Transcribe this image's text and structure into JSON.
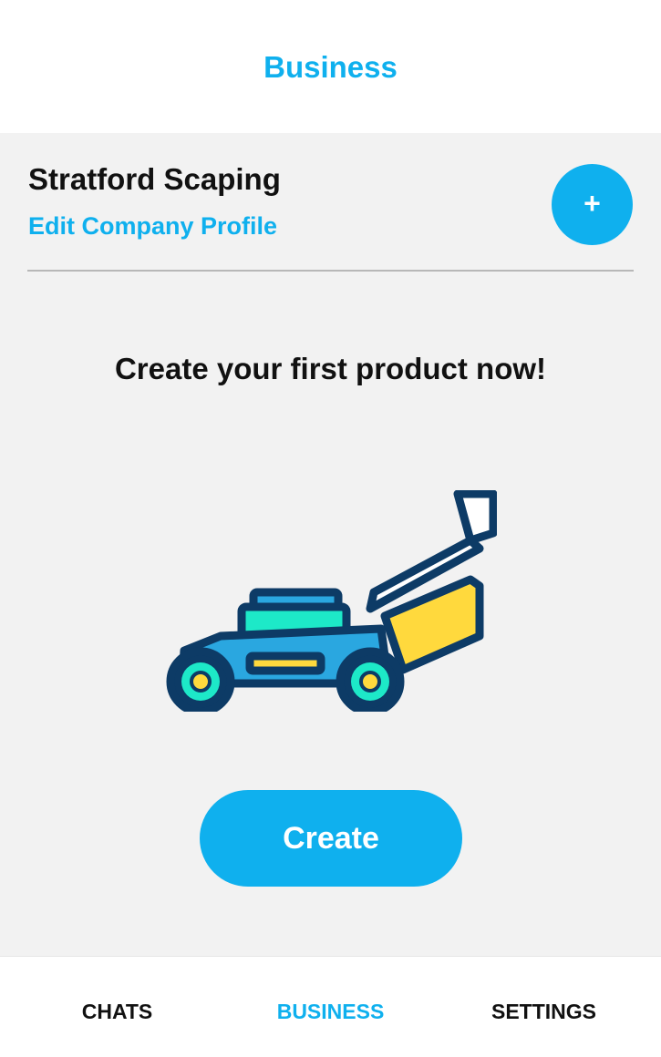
{
  "header": {
    "title": "Business"
  },
  "company": {
    "name": "Stratford Scaping",
    "edit_link": "Edit Company Profile",
    "add_label": "+"
  },
  "empty_state": {
    "prompt": "Create your first product now!",
    "illustration_icon": "lawn-mower-icon",
    "create_label": "Create"
  },
  "bottom_nav": {
    "tabs": [
      {
        "label": "CHATS",
        "active": false
      },
      {
        "label": "BUSINESS",
        "active": true
      },
      {
        "label": "SETTINGS",
        "active": false
      }
    ]
  },
  "colors": {
    "accent": "#0fb0ee",
    "background": "#f2f2f2",
    "text": "#111111",
    "mower_outline": "#0d3b66",
    "mower_body": "#2aa7e0",
    "mower_engine": "#1de9c8",
    "mower_bag": "#ffd93d"
  }
}
